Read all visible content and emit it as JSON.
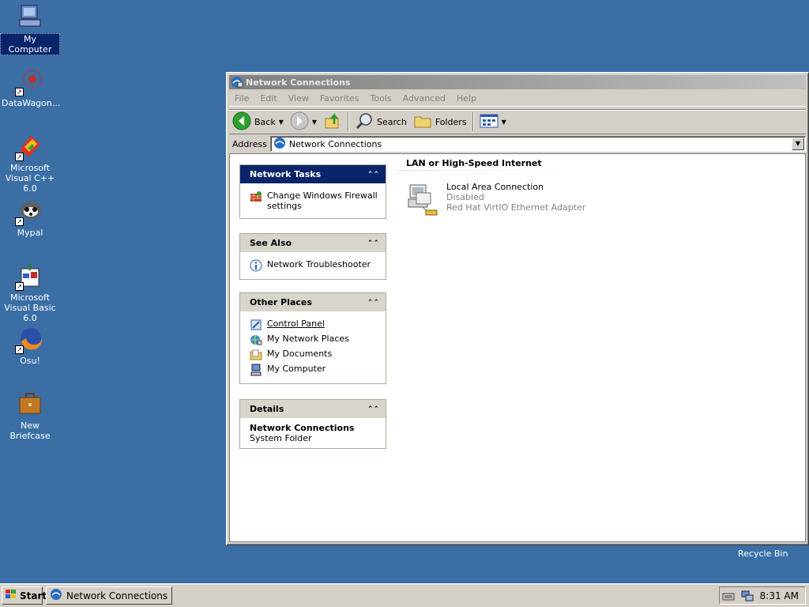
{
  "desktop": {
    "icons": [
      {
        "label": "My Computer"
      },
      {
        "label": "DataWagon..."
      },
      {
        "label": "Microsoft Visual C++ 6.0"
      },
      {
        "label": "Mypal"
      },
      {
        "label": "Microsoft Visual Basic 6.0"
      },
      {
        "label": "Osu!"
      },
      {
        "label": "New Briefcase"
      }
    ],
    "recycle_bin": "Recycle Bin"
  },
  "window": {
    "title": "Network Connections",
    "menu": [
      "File",
      "Edit",
      "View",
      "Favorites",
      "Tools",
      "Advanced",
      "Help"
    ],
    "toolbar": {
      "back": "Back",
      "search": "Search",
      "folders": "Folders"
    },
    "address": {
      "label": "Address",
      "value": "Network Connections"
    }
  },
  "taskpane": {
    "network_tasks": {
      "title": "Network Tasks",
      "items": [
        "Change Windows Firewall settings"
      ]
    },
    "see_also": {
      "title": "See Also",
      "items": [
        "Network Troubleshooter"
      ]
    },
    "other_places": {
      "title": "Other Places",
      "items": [
        "Control Panel",
        "My Network Places",
        "My Documents",
        "My Computer"
      ]
    },
    "details": {
      "title": "Details",
      "name": "Network Connections",
      "type": "System Folder"
    }
  },
  "connections": {
    "group_title": "LAN or High-Speed Internet",
    "items": [
      {
        "name": "Local Area Connection",
        "status": "Disabled",
        "device": "Red Hat VirtIO Ethernet Adapter"
      }
    ]
  },
  "taskbar": {
    "start": "Start",
    "task": "Network Connections",
    "clock": "8:31 AM"
  }
}
